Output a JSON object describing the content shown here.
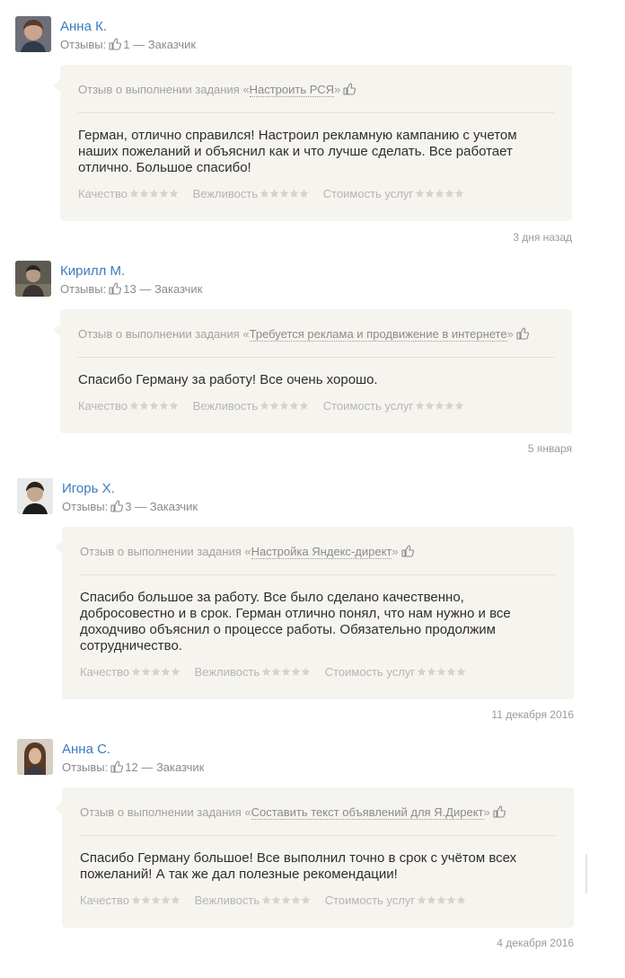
{
  "labels": {
    "reviews_prefix": "Отзывы:",
    "task_prefix": "Отзыв о выполнении задания",
    "quality": "Качество",
    "politeness": "Вежливость",
    "cost": "Стоимость услуг",
    "role_separator": "—"
  },
  "reviews": [
    {
      "name": "Анна К.",
      "likes": "1",
      "role": "Заказчик",
      "task": "Настроить РСЯ",
      "text": "Герман, отлично справился! Настроил рекламную кампанию с учетом наших пожеланий и объяснил как и что лучше сделать. Все работает отлично. Большое спасибо!",
      "date": "3 дня назад"
    },
    {
      "name": "Кирилл М.",
      "likes": "13",
      "role": "Заказчик",
      "task": "Требуется реклама и продвижение в интернете",
      "text": "Спасибо Герману за работу! Все очень хорошо.",
      "date": "5 января"
    },
    {
      "name": "Игорь Х.",
      "likes": "3",
      "role": "Заказчик",
      "task": "Настройка Яндекс-директ",
      "text": "Спасибо большое за работу. Все было сделано качественно, добросовестно и в срок. Герман отлично понял, что нам нужно и все доходчиво объяснил о процессе работы. Обязательно продолжим сотрудничество.",
      "date": "11 декабря 2016"
    },
    {
      "name": "Анна С.",
      "likes": "12",
      "role": "Заказчик",
      "task": "Составить текст объявлений для Я.Директ",
      "text": "Спасибо Герману большое! Все выполнил точно в срок с учётом всех пожеланий! А так же дал полезные рекомендации!",
      "date": "4 декабря 2016"
    }
  ],
  "icons": {
    "like": "thumbs-up-icon",
    "star": "star-icon"
  },
  "colors": {
    "name_link": "#3b7bc0",
    "card_bg": "#f6f4ee",
    "star": "#d6d3cc"
  }
}
